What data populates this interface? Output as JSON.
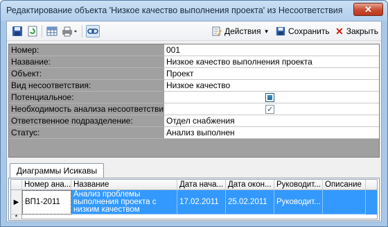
{
  "window": {
    "title": "Редактирование объекта 'Низкое качество выполнения проекта' из Несоответствия",
    "close_glyph": "✕"
  },
  "toolbar": {
    "actions_label": "Действия",
    "save_label": "Сохранить",
    "close_label": "Закрыть"
  },
  "properties": [
    {
      "label": "Номер:",
      "value": "001"
    },
    {
      "label": "Название:",
      "value": "Низкое качество выполнения проекта"
    },
    {
      "label": "Объект:",
      "value": "Проект"
    },
    {
      "label": "Вид несоответствия:",
      "value": "Низкое качество"
    },
    {
      "label": "Потенциальное:",
      "value": ""
    },
    {
      "label": "Необходимость анализа несоответствия:",
      "value": ""
    },
    {
      "label": "Ответственное подразделение:",
      "value": "Отдел снабжения"
    },
    {
      "label": "Статус:",
      "value": "Анализ выполнен"
    }
  ],
  "tabs": [
    {
      "label": "Диаграммы Исикавы"
    }
  ],
  "grid": {
    "columns": [
      "Номер ана...",
      "Название",
      "Дата нача...",
      "Дата окон...",
      "Руководит...",
      "Описание"
    ],
    "rows": [
      {
        "indicator": "▶",
        "cells": [
          "ВП1-2011",
          "Анализ проблемы выполнения проекта с низким качеством",
          "17.02.2011",
          "25.02.2011",
          "Руководит...",
          ""
        ]
      }
    ],
    "new_row_indicator": "*"
  },
  "colors": {
    "selection": "#3399ff",
    "propgrid_label_bg": "#a0a0a0",
    "close_red": "#cc2200"
  }
}
